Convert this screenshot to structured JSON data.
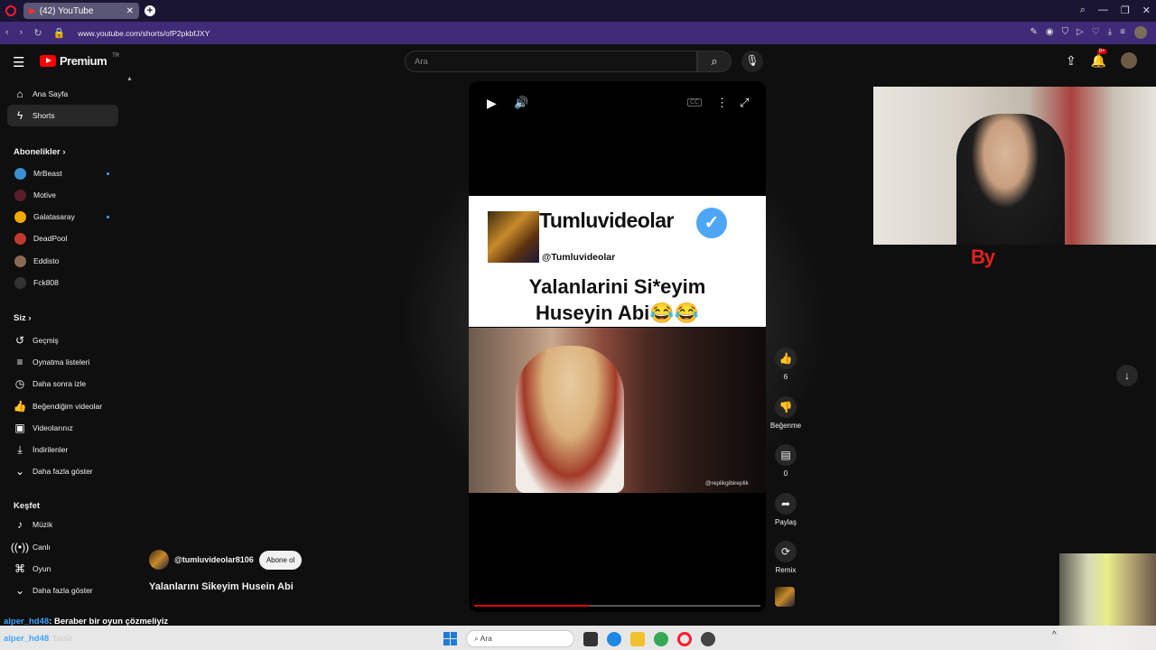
{
  "browser": {
    "tab_title": "(42) YouTube",
    "url": "www.youtube.com/shorts/ofP2pkbfJXY"
  },
  "header": {
    "logo_text": "Premium",
    "logo_region": "TR",
    "search_placeholder": "Ara",
    "notif_count": "9+"
  },
  "sidebar": {
    "home": "Ana Sayfa",
    "shorts": "Shorts",
    "subscriptions_heading": "Abonelikler",
    "subscriptions": [
      "MrBeast",
      "Motive",
      "Galatasaray",
      "DeadPool",
      "Eddisto",
      "Fck808"
    ],
    "you_heading": "Siz",
    "you_items": [
      "Geçmiş",
      "Oynatma listeleri",
      "Daha sonra izle",
      "Beğendiğim videolar",
      "Videolarınız",
      "İndirilenler",
      "Daha fazla göster"
    ],
    "explore_heading": "Keşfet",
    "explore_items": [
      "Müzik",
      "Canlı",
      "Oyun",
      "Daha fazla göster"
    ]
  },
  "player": {
    "card_channel": "Tumluvideolar",
    "card_handle": "@Tumluvideolar",
    "card_line1": "Yalanlarini Si*eyim",
    "card_line2": "Huseyin Abi😂😂",
    "cc_label": "CC",
    "watermark": "@replikgibireplik",
    "progress": 0.4
  },
  "actions": {
    "like_count": "6",
    "dislike_label": "Beğenme",
    "comment_count": "0",
    "share_label": "Paylaş",
    "remix_label": "Remix"
  },
  "video": {
    "channel": "@tumluvideolar8106",
    "subscribe_label": "Abone ol",
    "title": "Yalanlarını Sikeyim Husein Abi"
  },
  "overlay": {
    "text": "By"
  },
  "chat": {
    "line1_user": "alper_hd48",
    "line1_text": ": Beraber bir oyun çözmeliyiz",
    "line2_user": "alper_hd48",
    "line2_text": ": basit"
  },
  "taskbar": {
    "search_label": "Ara"
  }
}
